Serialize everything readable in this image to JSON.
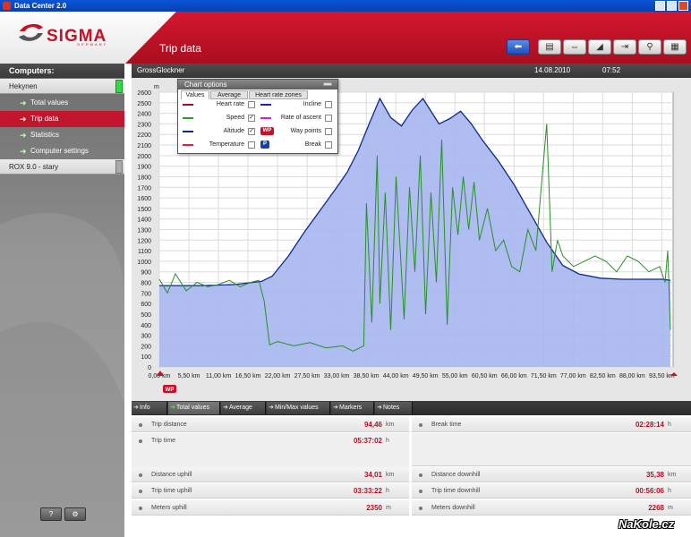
{
  "window": {
    "title": "Data Center 2.0"
  },
  "brand": {
    "logo": "SIGMA",
    "logo_sub": "GERMANY"
  },
  "header": {
    "page_title": "Trip data"
  },
  "toolbar": {
    "icons": [
      "back-arrow-icon",
      "export-icon",
      "exchange-icon",
      "eraser-icon",
      "distance-icon",
      "zoom-icon",
      "print-icon"
    ]
  },
  "sidebar": {
    "heading": "Computers:",
    "devices": [
      "Hekynen",
      "ROX 9.0 - stary"
    ],
    "items": [
      {
        "label": "Total values"
      },
      {
        "label": "Trip data"
      },
      {
        "label": "Statistics"
      },
      {
        "label": "Computer settings"
      }
    ],
    "bottom": {
      "help": "?",
      "settings": "⚙"
    }
  },
  "chart_header": {
    "trip_name": "GrossGlockner",
    "date": "14.08.2010",
    "time": "07:52"
  },
  "chart_options": {
    "title": "Chart options",
    "tabs": [
      "Values",
      "Average",
      "Heart rate zones"
    ],
    "left": [
      {
        "label": "Heart rate",
        "color": "#a01020",
        "checked": false
      },
      {
        "label": "Speed",
        "color": "#2a9a2a",
        "checked": true
      },
      {
        "label": "Altitude",
        "color": "#0d2a8c",
        "checked": true
      },
      {
        "label": "Temperature",
        "color": "#e0203a",
        "checked": false
      }
    ],
    "right": [
      {
        "label": "Incline",
        "color": "#2020c0",
        "checked": false
      },
      {
        "label": "Rate of ascent",
        "color": "#d020d0",
        "checked": false
      },
      {
        "label": "Way points",
        "badge": "WP",
        "checked": false
      },
      {
        "label": "Break",
        "badge": "P",
        "checked": false
      }
    ]
  },
  "chart_data": {
    "type": "area",
    "ylabel": "m",
    "ylim": [
      0,
      2600
    ],
    "yticks": [
      0,
      100,
      200,
      300,
      400,
      500,
      600,
      700,
      800,
      900,
      1000,
      1100,
      1200,
      1300,
      1400,
      1500,
      1600,
      1700,
      1800,
      1900,
      2000,
      2100,
      2200,
      2300,
      2400,
      2500,
      2600
    ],
    "xlim": [
      0,
      95.5
    ],
    "xtick_labels": [
      "0,00 km",
      "5,50 km",
      "11,00 km",
      "16,50 km",
      "22,00 km",
      "27,50 km",
      "33,00 km",
      "38,50 km",
      "44,00 km",
      "49,50 km",
      "55,00 km",
      "60,50 km",
      "66,00 km",
      "71,50 km",
      "77,00 km",
      "82,50 km",
      "88,00 km",
      "93,50 km"
    ],
    "grid": true,
    "marker": "WP",
    "series": [
      {
        "name": "Altitude",
        "color": "#0d2a8c",
        "fill": "#a6b6ee",
        "x": [
          0,
          8,
          14,
          19,
          21,
          24,
          27,
          30,
          33,
          35,
          37,
          39,
          41,
          43,
          45,
          47,
          49,
          50,
          52,
          54,
          56,
          58,
          60,
          63,
          66,
          69,
          72,
          75,
          78,
          82,
          86,
          90,
          93.5,
          95
        ],
        "y": [
          770,
          770,
          780,
          810,
          860,
          1050,
          1280,
          1490,
          1700,
          1850,
          2050,
          2300,
          2540,
          2360,
          2280,
          2430,
          2540,
          2460,
          2300,
          2350,
          2420,
          2300,
          2150,
          1950,
          1720,
          1450,
          1180,
          960,
          880,
          840,
          830,
          830,
          830,
          820
        ]
      },
      {
        "name": "Speed",
        "color": "#2a8f2a",
        "x": [
          0,
          1.5,
          3,
          5,
          7,
          9,
          11,
          13,
          15,
          17,
          18.5,
          19.5,
          20.5,
          22,
          25,
          28,
          31,
          34,
          36,
          38,
          38.5,
          39.5,
          40.5,
          41,
          42,
          43,
          44,
          45.5,
          46.5,
          47.5,
          48.5,
          49.5,
          50.5,
          51.5,
          52.5,
          53.5,
          54.5,
          55.5,
          56.5,
          57.5,
          58.5,
          59.5,
          61,
          62.5,
          64,
          65.5,
          67,
          68.5,
          70,
          71,
          72,
          73,
          74,
          75,
          77,
          79,
          81,
          83,
          85,
          87,
          89,
          91,
          93,
          94,
          94.5,
          95
        ],
        "y": [
          830,
          700,
          880,
          720,
          800,
          760,
          780,
          820,
          760,
          800,
          820,
          620,
          210,
          240,
          200,
          230,
          180,
          200,
          150,
          200,
          1550,
          420,
          2000,
          600,
          1650,
          350,
          1800,
          450,
          1700,
          900,
          2000,
          500,
          1650,
          800,
          2150,
          400,
          1700,
          1250,
          1800,
          1300,
          1750,
          1200,
          1500,
          1100,
          1200,
          950,
          900,
          1300,
          1100,
          1700,
          2300,
          900,
          1200,
          1050,
          950,
          1000,
          1050,
          1000,
          900,
          1050,
          1000,
          900,
          950,
          800,
          1100,
          350
        ]
      }
    ]
  },
  "stats_tabs": [
    "Info",
    "Total values",
    "Average",
    "Min/Max values",
    "Markers",
    "Notes"
  ],
  "stats": {
    "left": [
      {
        "label": "Trip distance",
        "value": "94,46",
        "unit": "km"
      },
      {
        "label": "Trip time",
        "value": "05:37:02",
        "unit": "h"
      },
      {
        "label": "Distance uphill",
        "value": "34,01",
        "unit": "km"
      },
      {
        "label": "Trip time uphill",
        "value": "03:33:22",
        "unit": "h"
      },
      {
        "label": "Meters uphill",
        "value": "2350",
        "unit": "m"
      }
    ],
    "right": [
      {
        "label": "Break time",
        "value": "02:28:14",
        "unit": "h"
      },
      {
        "label": "Distance downhill",
        "value": "35,38",
        "unit": "km"
      },
      {
        "label": "Trip time downhill",
        "value": "00:56:06",
        "unit": "h"
      },
      {
        "label": "Meters downhill",
        "value": "2268",
        "unit": "m"
      }
    ]
  },
  "watermark": "NaKole.cz"
}
